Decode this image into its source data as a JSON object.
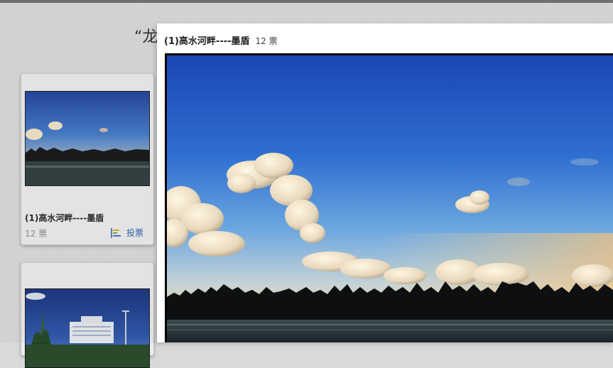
{
  "page": {
    "title": "“龙"
  },
  "cards": [
    {
      "title": "(1)高水河畔----墨盾",
      "votes": "12 票",
      "vote_label": "投票"
    }
  ],
  "lightbox": {
    "title": "(1)高水河畔----墨盾",
    "votes": "12 票"
  },
  "icons": {
    "vote": "vote-chart-icon"
  },
  "colors": {
    "sky_top": "#1d4fb8",
    "sky_horizon": "#f2d7a0",
    "link": "#2b5ea8"
  }
}
